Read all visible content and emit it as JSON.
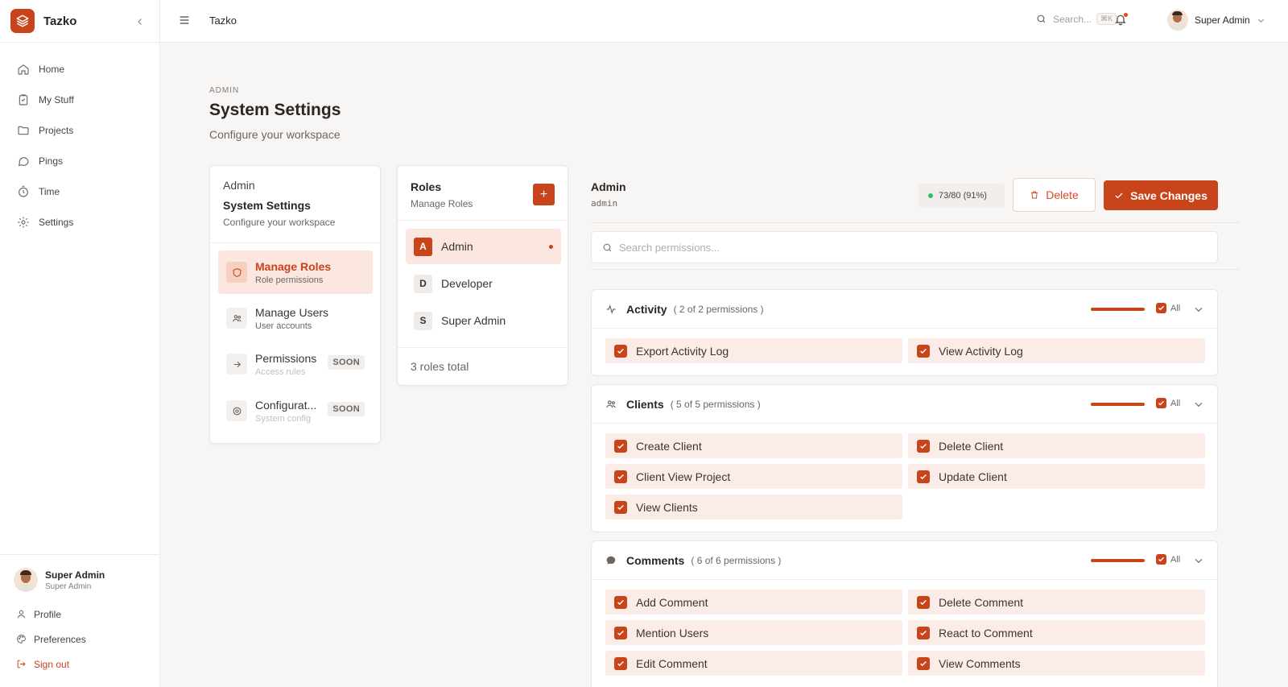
{
  "app": {
    "name": "Tazko"
  },
  "sidebar": {
    "items": [
      {
        "label": "Home"
      },
      {
        "label": "My Stuff"
      },
      {
        "label": "Projects"
      },
      {
        "label": "Pings"
      },
      {
        "label": "Time"
      },
      {
        "label": "Settings"
      }
    ],
    "user": {
      "name": "Super Admin",
      "role": "Super Admin"
    },
    "links": {
      "profile": "Profile",
      "preferences": "Preferences",
      "signout": "Sign out"
    }
  },
  "topbar": {
    "title": "Tazko",
    "search_placeholder": "Search...",
    "search_shortcut": "⌘K",
    "user_name": "Super Admin"
  },
  "page": {
    "eyebrow": "ADMIN",
    "title": "System Settings",
    "subtitle": "Configure your workspace"
  },
  "settings_menu": {
    "crumb": "Admin",
    "title": "System Settings",
    "subtitle": "Configure your workspace",
    "items": [
      {
        "label": "Manage Roles",
        "desc": "Role permissions"
      },
      {
        "label": "Manage Users",
        "desc": "User accounts"
      },
      {
        "label": "Permissions",
        "desc": "Access rules",
        "badge": "SOON"
      },
      {
        "label": "Configurat...",
        "desc": "System config",
        "badge": "SOON"
      }
    ]
  },
  "roles": {
    "title": "Roles",
    "subtitle": "Manage Roles",
    "add_label": "+",
    "items": [
      {
        "letter": "A",
        "name": "Admin"
      },
      {
        "letter": "D",
        "name": "Developer"
      },
      {
        "letter": "S",
        "name": "Super Admin"
      }
    ],
    "total": "3 roles total"
  },
  "detail": {
    "name": "Admin",
    "slug": "admin",
    "count": "73/80 (91%)",
    "delete_label": "Delete",
    "save_label": "Save Changes",
    "search_placeholder": "Search permissions..."
  },
  "groups": [
    {
      "title": "Activity",
      "count": "( 2 of 2 permissions )",
      "enabled_fraction": 1.0,
      "all_label": "All",
      "permissions": [
        "Export Activity Log",
        "View Activity Log"
      ]
    },
    {
      "title": "Clients",
      "count": "( 5 of 5 permissions )",
      "enabled_fraction": 1.0,
      "all_label": "All",
      "permissions": [
        "Create Client",
        "Delete Client",
        "Client View Project",
        "Update Client",
        "View Clients"
      ]
    },
    {
      "title": "Comments",
      "count": "( 6 of 6 permissions )",
      "enabled_fraction": 1.0,
      "all_label": "All",
      "permissions": [
        "Add Comment",
        "Delete Comment",
        "Mention Users",
        "React to Comment",
        "Edit Comment",
        "View Comments"
      ]
    }
  ],
  "colors": {
    "accent": "#c8441a",
    "accent_soft": "#fbe7e0",
    "success": "#2fbf6f"
  }
}
